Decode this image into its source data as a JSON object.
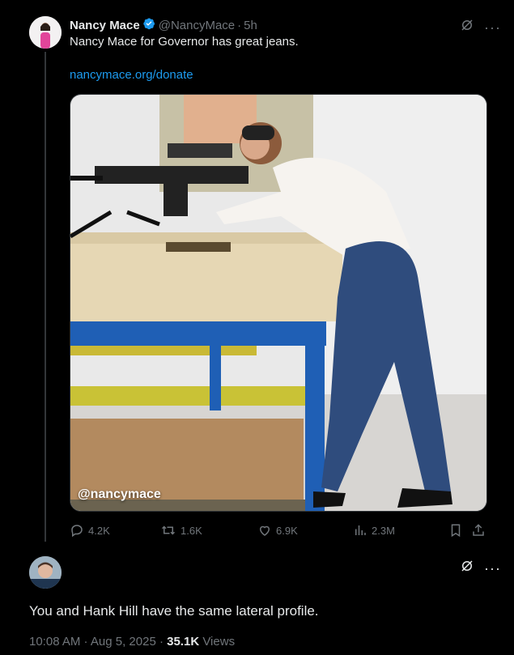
{
  "tweet": {
    "author_name": "Nancy Mace",
    "handle": "@NancyMace",
    "separator": "·",
    "time": "5h",
    "text": "Nancy Mace for Governor has great jeans.",
    "link": "nancymace.org/donate",
    "media_watermark": "@nancymace",
    "stats": {
      "replies": "4.2K",
      "retweets": "1.6K",
      "likes": "6.9K",
      "views": "2.3M"
    }
  },
  "reply": {
    "text": "You and Hank Hill have the same lateral profile.",
    "timestamp": "10:08 AM · Aug 5, 2025 · ",
    "views_count": "35.1K",
    "views_label": " Views"
  },
  "icons": {
    "verified": "verified-badge-icon",
    "grok": "grok-icon",
    "more": "more-icon",
    "reply": "reply-icon",
    "retweet": "retweet-icon",
    "like": "heart-icon",
    "views": "views-icon",
    "bookmark": "bookmark-icon",
    "share": "share-icon"
  },
  "colors": {
    "background": "#000000",
    "text": "#e7e9ea",
    "muted": "#71767b",
    "accent": "#1d9bf0",
    "thread_line": "#333639"
  }
}
